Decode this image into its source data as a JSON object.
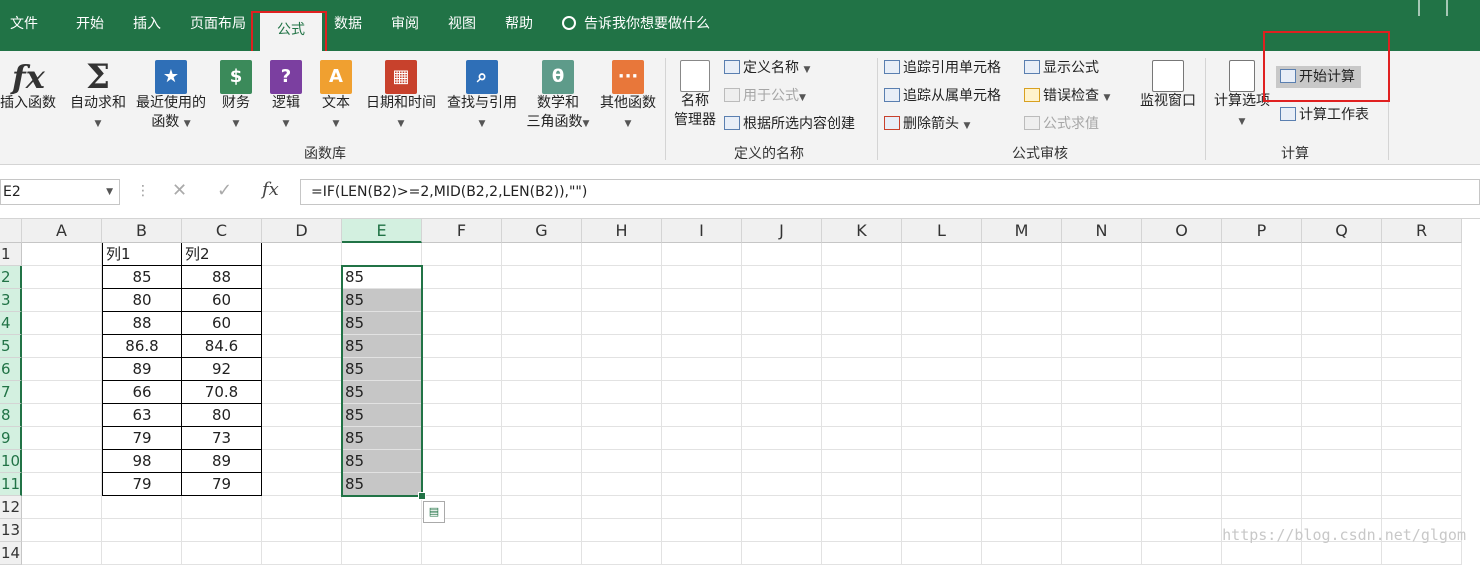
{
  "tabs": [
    {
      "label": "文件",
      "active": false
    },
    {
      "label": "开始",
      "active": false
    },
    {
      "label": "插入",
      "active": false
    },
    {
      "label": "页面布局",
      "active": false
    },
    {
      "label": "公式",
      "active": true
    },
    {
      "label": "数据",
      "active": false
    },
    {
      "label": "审阅",
      "active": false
    },
    {
      "label": "视图",
      "active": false
    },
    {
      "label": "帮助",
      "active": false
    }
  ],
  "tell_me": "告诉我你想要做什么",
  "ribbon": {
    "function_library": {
      "insert_function": "插入函数",
      "autosum": "自动求和",
      "recent_1": "最近使用的",
      "recent_2": "函数",
      "financial": "财务",
      "logical": "逻辑",
      "text": "文本",
      "datetime": "日期和时间",
      "lookup": "查找与引用",
      "math_1": "数学和",
      "math_2": "三角函数",
      "more": "其他函数",
      "group_label": "函数库"
    },
    "defined_names": {
      "name_manager_1": "名称",
      "name_manager_2": "管理器",
      "define_name": "定义名称",
      "use_in_formula": "用于公式",
      "create_from_selection": "根据所选内容创建",
      "group_label": "定义的名称"
    },
    "formula_auditing": {
      "trace_precedents": "追踪引用单元格",
      "trace_dependents": "追踪从属单元格",
      "remove_arrows": "删除箭头",
      "show_formulas": "显示公式",
      "error_checking": "错误检查",
      "evaluate_formula": "公式求值",
      "watch_window": "监视窗口",
      "group_label": "公式审核"
    },
    "calculation": {
      "options": "计算选项",
      "calc_now": "开始计算",
      "calc_sheet": "计算工作表",
      "group_label": "计算"
    },
    "icons": {
      "fx": "fx",
      "sigma": "Σ",
      "star": "★",
      "coins": "$",
      "question": "?",
      "letter_a": "A",
      "calendar": "▦",
      "magnifier": "⌕",
      "theta": "θ",
      "dots": "···"
    }
  },
  "formula_bar": {
    "name_box": "E2",
    "fx": "fx",
    "formula": "=IF(LEN(B2)>=2,MID(B2,2,LEN(B2)),\"\")"
  },
  "grid": {
    "columns": [
      "A",
      "B",
      "C",
      "D",
      "E",
      "F",
      "G",
      "H",
      "I",
      "J",
      "K",
      "L",
      "M",
      "N",
      "O",
      "P",
      "Q",
      "R"
    ],
    "rows": [
      "1",
      "2",
      "3",
      "4",
      "5",
      "6",
      "7",
      "8",
      "9",
      "10",
      "11",
      "12",
      "13",
      "14"
    ],
    "headers": {
      "B": "列1",
      "C": "列2"
    },
    "col_b": [
      "85",
      "80",
      "88",
      "86.8",
      "89",
      "66",
      "63",
      "79",
      "98",
      "79"
    ],
    "col_c": [
      "88",
      "60",
      "60",
      "84.6",
      "92",
      "70.8",
      "80",
      "73",
      "89",
      "79"
    ],
    "col_e": [
      "85",
      "85",
      "85",
      "85",
      "85",
      "85",
      "85",
      "85",
      "85",
      "85"
    ]
  },
  "watermark": "https://blog.csdn.net/glgom",
  "colors": {
    "brand": "#217346",
    "selection": "#c6c6c6",
    "highlight": "#e02020"
  }
}
